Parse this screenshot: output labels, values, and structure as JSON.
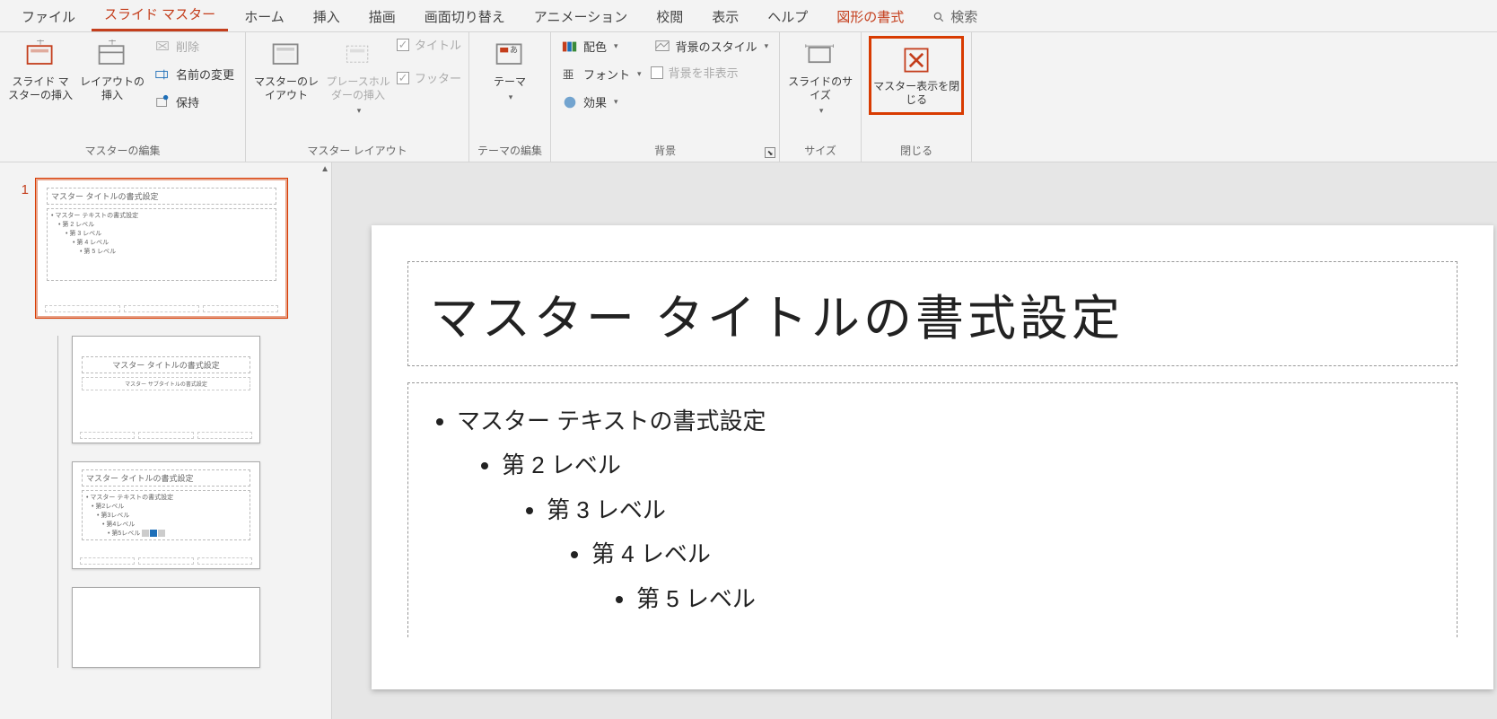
{
  "tabs": {
    "file": "ファイル",
    "slide_master": "スライド マスター",
    "home": "ホーム",
    "insert": "挿入",
    "draw": "描画",
    "transitions": "画面切り替え",
    "animations": "アニメーション",
    "review": "校閲",
    "view": "表示",
    "help": "ヘルプ",
    "shape_format": "図形の書式",
    "search": "検索"
  },
  "ribbon": {
    "edit_master": {
      "label": "マスターの編集",
      "insert_slide_master": "スライド マスターの挿入",
      "insert_layout": "レイアウトの挿入",
      "delete": "削除",
      "rename": "名前の変更",
      "preserve": "保持"
    },
    "master_layout": {
      "label": "マスター レイアウト",
      "master_layout_btn": "マスターのレイアウト",
      "insert_placeholder": "プレースホルダーの挿入",
      "title_chk": "タイトル",
      "footer_chk": "フッター"
    },
    "edit_theme": {
      "label": "テーマの編集",
      "themes": "テーマ"
    },
    "background": {
      "label": "背景",
      "colors": "配色",
      "fonts": "フォント",
      "effects": "効果",
      "bg_styles": "背景のスタイル",
      "hide_bg": "背景を非表示"
    },
    "size": {
      "label": "サイズ",
      "slide_size": "スライドのサイズ"
    },
    "close": {
      "label": "閉じる",
      "close_master": "マスター表示を閉じる"
    }
  },
  "sidebar": {
    "num1": "1",
    "master_thumb": {
      "title": "マスター タイトルの書式設定",
      "body": "• マスター テキストの書式設定",
      "l2": "• 第 2 レベル",
      "l3": "• 第 3 レベル",
      "l4": "• 第 4 レベル",
      "l5": "• 第 5 レベル"
    },
    "layout_thumb1": {
      "title": "マスター タイトルの書式設定",
      "sub": "マスター サブタイトルの書式設定"
    },
    "layout_thumb2": {
      "title": "マスター タイトルの書式設定",
      "body": "• マスター テキストの書式設定",
      "l2": "• 第2レベル",
      "l3": "• 第3レベル",
      "l4": "• 第4レベル",
      "l5": "• 第5レベル"
    }
  },
  "slide": {
    "title": "マスター タイトルの書式設定",
    "b0": "マスター テキストの書式設定",
    "b1": "第 2 レベル",
    "b2": "第 3 レベル",
    "b3": "第 4 レベル",
    "b4": "第 5 レベル"
  }
}
